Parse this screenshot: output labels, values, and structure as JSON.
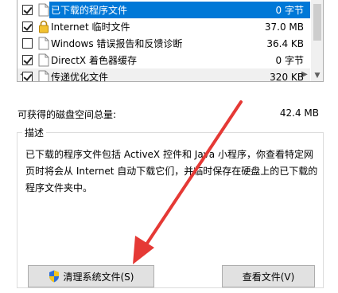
{
  "file_list": {
    "items": [
      {
        "checked": true,
        "icon": "file-icon",
        "label": "已下载的程序文件",
        "size": "0 字节",
        "selected": true
      },
      {
        "checked": true,
        "icon": "lock-icon",
        "label": "Internet 临时文件",
        "size": "37.0 MB",
        "selected": false
      },
      {
        "checked": false,
        "icon": "file-icon",
        "label": "Windows 错误报告和反馈诊断",
        "size": "36.4 KB",
        "selected": false
      },
      {
        "checked": true,
        "icon": "file-icon",
        "label": "DirectX 着色器缓存",
        "size": "0 字节",
        "selected": false
      },
      {
        "checked": true,
        "icon": "file-icon",
        "label": "传递优化文件",
        "size": "320 KB",
        "selected": false
      }
    ]
  },
  "total": {
    "label": "可获得的磁盘空间总量:",
    "value": "42.4 MB"
  },
  "description": {
    "title": "描述",
    "text": "已下载的程序文件包括 ActiveX 控件和 Java 小程序，你查看特定网页时将会从 Internet 自动下载它们，并临时保存在硬盘上的已下载的程序文件夹中。"
  },
  "buttons": {
    "clean_system": "清理系统文件(S)",
    "view_files": "查看文件(V)"
  },
  "colors": {
    "selection": "#0078d7",
    "annotation_arrow": "#e53935"
  }
}
